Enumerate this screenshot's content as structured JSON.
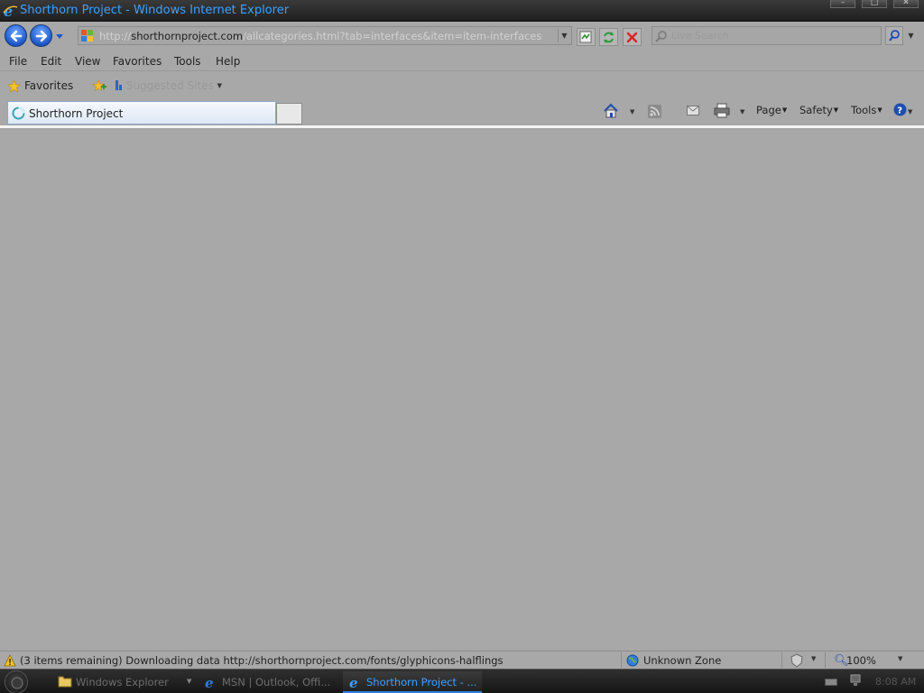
{
  "window": {
    "title": "Shorthorn Project - Windows Internet Explorer",
    "controls": {
      "minimize": "–",
      "maximize": "□",
      "close": "✕"
    }
  },
  "nav": {
    "url_prefix": "http://",
    "url_host": "shorthornproject.com",
    "url_path": "/allcategories.html?tab=interfaces&item=item-interfaces",
    "search_placeholder": "Live Search"
  },
  "menu": {
    "items": [
      "File",
      "Edit",
      "View",
      "Favorites",
      "Tools",
      "Help"
    ]
  },
  "favorites_bar": {
    "favorites_label": "Favorites",
    "suggested_label": "Suggested Sites"
  },
  "tabs": {
    "active_label": "Shorthorn Project"
  },
  "command_bar": {
    "page": "Page",
    "safety": "Safety",
    "tools": "Tools"
  },
  "status": {
    "text": "(3 items remaining) Downloading data http://shorthornproject.com/fonts/glyphicons-halflings",
    "zone": "Unknown Zone",
    "zoom": "100%"
  },
  "taskbar": {
    "items": [
      {
        "label": "Windows Explorer",
        "active": false
      },
      {
        "label": "MSN | Outlook, Offi...",
        "active": false
      },
      {
        "label": "Shorthorn Project - ...",
        "active": true
      }
    ],
    "clock": "8:08 AM"
  },
  "colors": {
    "title_text": "#3ea0ff",
    "content_bg": "#a8a8a8",
    "nav_button": "#1d57c9",
    "active_task_accent": "#2f7de0"
  }
}
